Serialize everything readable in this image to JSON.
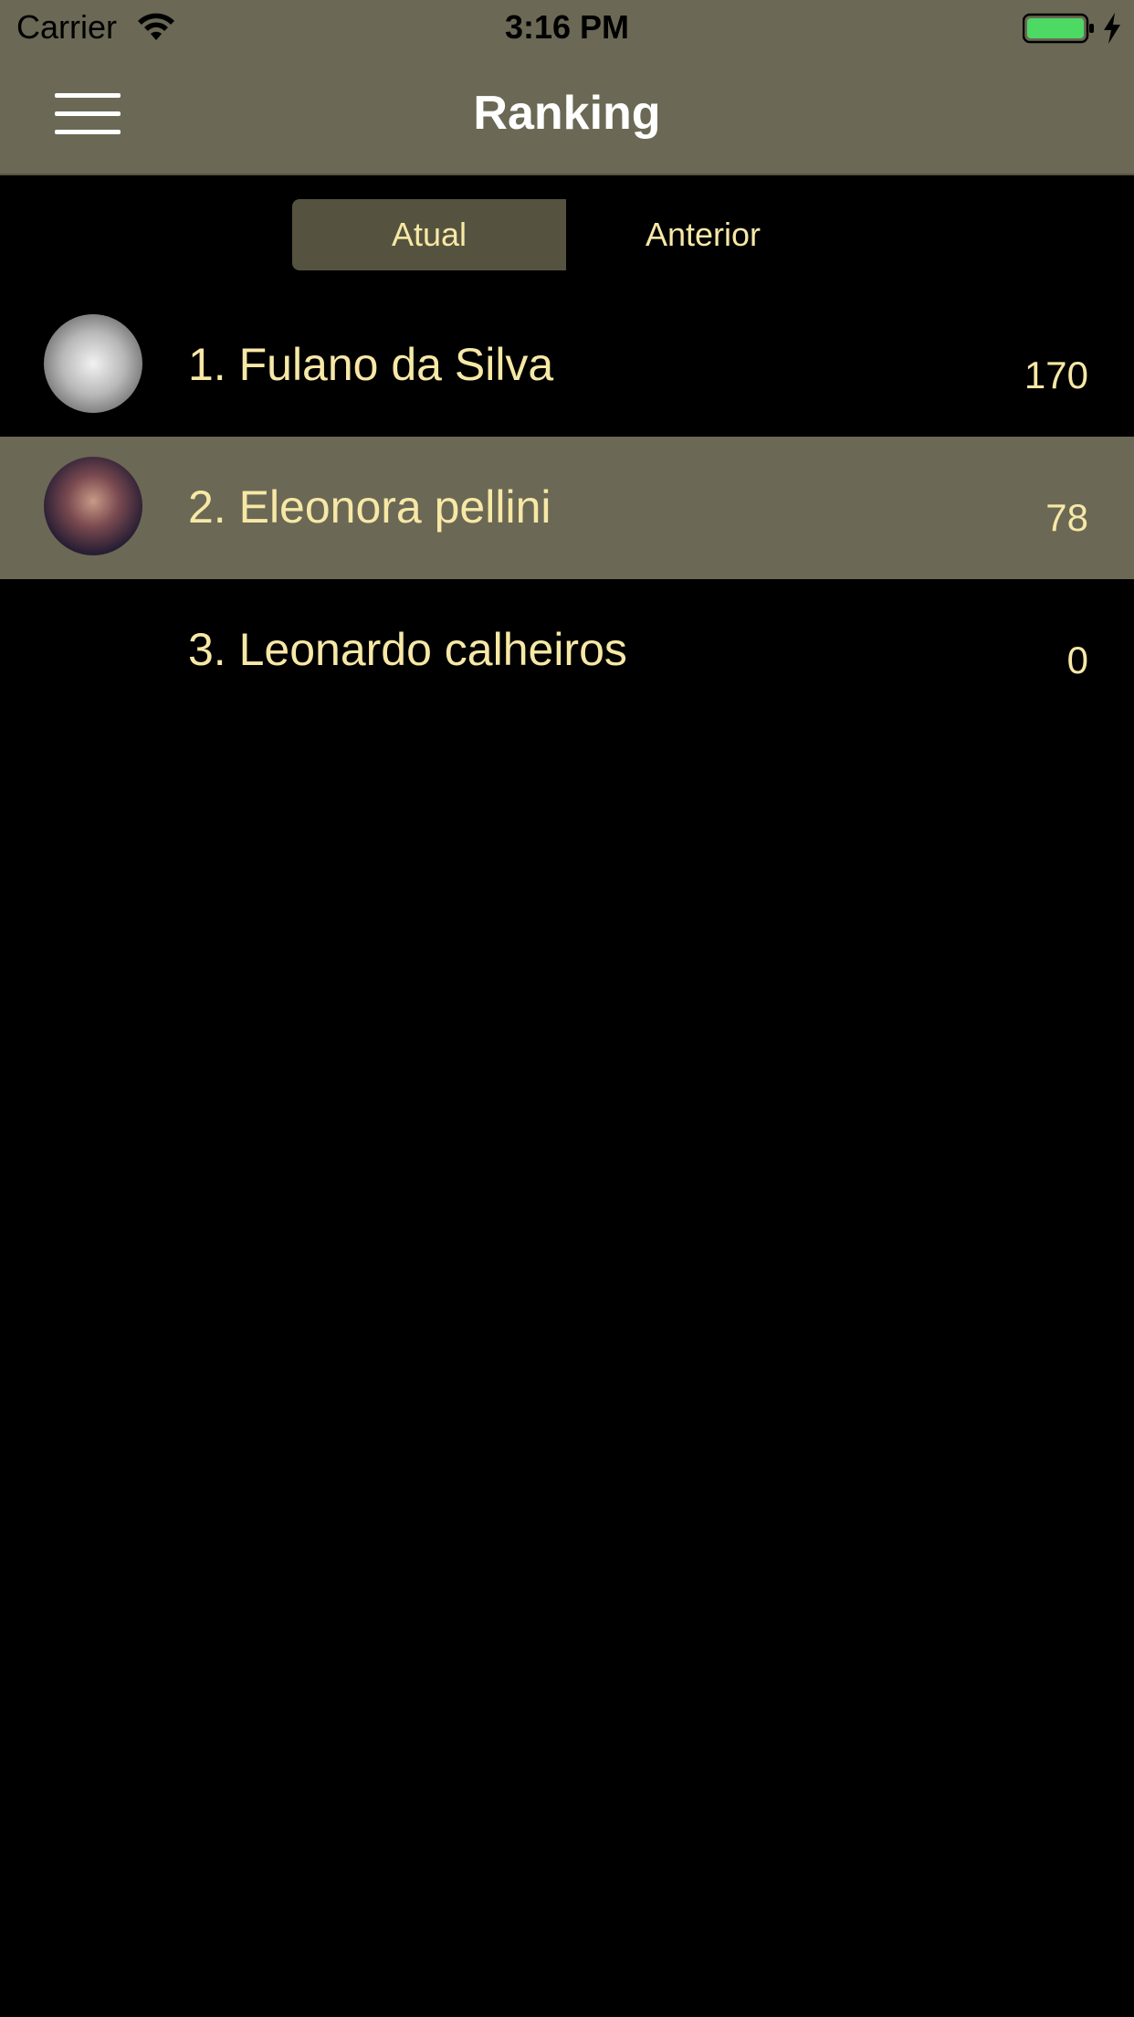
{
  "status_bar": {
    "carrier": "Carrier",
    "time": "3:16 PM",
    "battery_color": "#4cd964"
  },
  "nav": {
    "title": "Ranking",
    "menu_icon": "hamburger-menu-icon"
  },
  "tabs": [
    {
      "label": "Atual",
      "selected": true
    },
    {
      "label": "Anterior",
      "selected": false
    }
  ],
  "ranking": [
    {
      "name": "1. Fulano da Silva",
      "score": "170",
      "has_avatar": true,
      "highlighted": false
    },
    {
      "name": "2. Eleonora pellini",
      "score": "78",
      "has_avatar": true,
      "highlighted": true
    },
    {
      "name": "3. Leonardo calheiros",
      "score": "0",
      "has_avatar": false,
      "highlighted": false
    }
  ],
  "colors": {
    "header_background": "#6b6855",
    "page_background": "#000000",
    "accent_text": "#f7e8a6",
    "selected_segment": "#55533f"
  }
}
